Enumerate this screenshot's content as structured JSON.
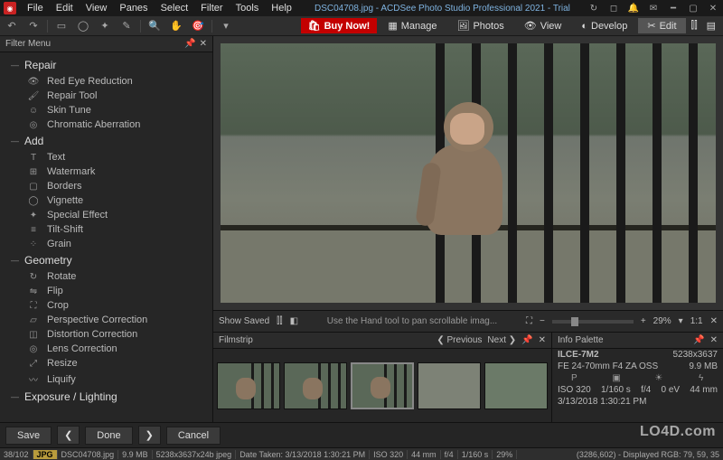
{
  "app": {
    "title": "DSC04708.jpg - ACDSee Photo Studio Professional 2021 - Trial",
    "buy_now": "Buy Now!"
  },
  "menubar": [
    "File",
    "Edit",
    "View",
    "Panes",
    "Select",
    "Filter",
    "Tools",
    "Help"
  ],
  "modes": {
    "manage": "Manage",
    "photos": "Photos",
    "view": "View",
    "develop": "Develop",
    "edit": "Edit"
  },
  "filter_panel": {
    "title": "Filter Menu",
    "groups": [
      {
        "name": "Repair",
        "items": [
          "Red Eye Reduction",
          "Repair Tool",
          "Skin Tune",
          "Chromatic Aberration"
        ]
      },
      {
        "name": "Add",
        "items": [
          "Text",
          "Watermark",
          "Borders",
          "Vignette",
          "Special Effect",
          "Tilt-Shift",
          "Grain"
        ]
      },
      {
        "name": "Geometry",
        "items": [
          "Rotate",
          "Flip",
          "Crop",
          "Perspective Correction",
          "Distortion Correction",
          "Lens Correction",
          "Resize",
          "Liquify"
        ]
      },
      {
        "name": "Exposure / Lighting",
        "items": []
      }
    ]
  },
  "actions": {
    "save": "Save",
    "done": "Done",
    "cancel": "Cancel"
  },
  "viewer": {
    "show_saved": "Show Saved",
    "hint": "Use the Hand tool to pan scrollable imag...",
    "zoom": "29%",
    "ratio": "1:1"
  },
  "filmstrip": {
    "title": "Filmstrip",
    "prev": "Previous",
    "next": "Next"
  },
  "info": {
    "title": "Info Palette",
    "camera": "ILCE-7M2",
    "lens": "FE 24-70mm F4 ZA OSS",
    "dims": "5238x3637",
    "size": "9.9 MB",
    "mode": "P",
    "iso": "ISO 320",
    "shutter": "1/160 s",
    "aperture": "f/4",
    "ev": "0 eV",
    "focal": "44 mm",
    "date": "3/13/2018 1:30:21 PM"
  },
  "status": {
    "idx": "38/102",
    "badge": "JPG",
    "fname": "DSC04708.jpg",
    "fsize": "9.9 MB",
    "fdims": "5238x3637x24b jpeg",
    "date_label": "Date Taken: 3/13/2018 1:30:21 PM",
    "iso": "ISO 320",
    "focal": "44 mm",
    "ap": "f/4",
    "sh": "1/160 s",
    "zm": "29%",
    "right": "(3286,602) - Displayed RGB: 79, 59, 35"
  },
  "watermark": "LO4D.com"
}
